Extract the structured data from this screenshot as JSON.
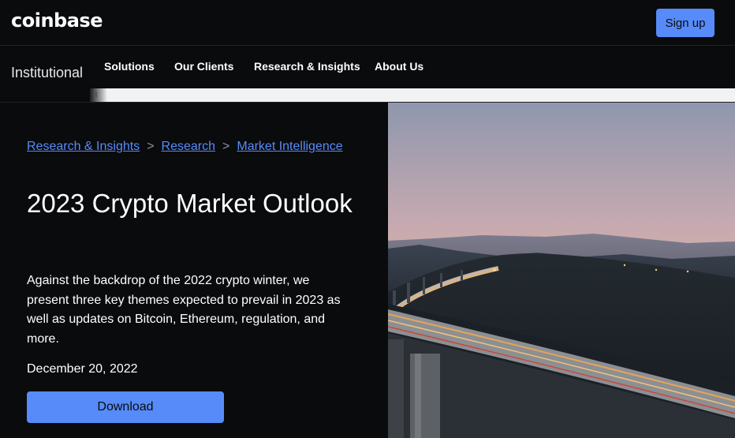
{
  "header": {
    "logo": "coinbase",
    "signup_label": "Sign up"
  },
  "subnav": {
    "brand": "Institutional",
    "items": [
      {
        "label": "Solutions"
      },
      {
        "label": "Our Clients"
      },
      {
        "label": "Research & Insights"
      },
      {
        "label": "About Us"
      }
    ]
  },
  "breadcrumb": {
    "items": [
      "Research & Insights",
      "Research",
      "Market Intelligence"
    ],
    "separator": ">"
  },
  "article": {
    "title": "2023 Crypto Market Outlook",
    "description": "Against the backdrop of the 2022 crypto winter, we present three key themes expected to prevail in 2023 as well as updates on Bitcoin, Ethereum, regulation, and more.",
    "date": "December 20, 2022",
    "download_label": "Download"
  },
  "colors": {
    "background": "#0a0b0d",
    "accent": "#578bfa",
    "text": "#ffffff"
  },
  "icons": {
    "scroll_left": "chevron-left-icon"
  }
}
